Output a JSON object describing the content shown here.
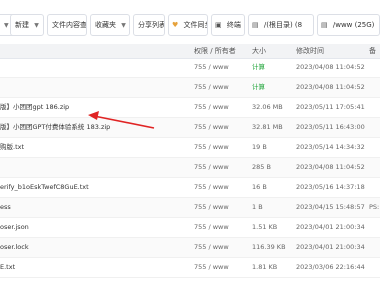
{
  "toolbar": {
    "btn_partial": "",
    "new_label": "新建",
    "search_label": "文件内容查找",
    "favorites_label": "收藏夹",
    "share_label": "分享列表",
    "sync_label": "文件同步",
    "terminal_label": "终端",
    "root_dir_label": "/(根目录) (8",
    "www_dir_label": "/www (25G)"
  },
  "table": {
    "columns": [
      "权限 / 所有者",
      "大小",
      "修改时间",
      "备"
    ],
    "rows": [
      {
        "name": "",
        "perm": "755 / www",
        "size": "计算",
        "time": "2023/04/08 11:04:52",
        "extra": "",
        "calc": true
      },
      {
        "name": "",
        "perm": "755 / www",
        "size": "计算",
        "time": "2023/04/08 11:04:52",
        "extra": "",
        "calc": true
      },
      {
        "name": "版】小团团gpt 186.zip",
        "perm": "755 / www",
        "size": "32.06 MB",
        "time": "2023/05/11 17:05:41",
        "extra": ""
      },
      {
        "name": "版】小团团GPT付费体验系统 183.zip",
        "perm": "755 / www",
        "size": "32.81 MB",
        "time": "2023/05/11 16:43:00",
        "extra": ""
      },
      {
        "name": "购版.txt",
        "perm": "755 / www",
        "size": "19 B",
        "time": "2023/05/14 14:34:32",
        "extra": ""
      },
      {
        "name": "",
        "perm": "755 / www",
        "size": "285 B",
        "time": "2023/04/08 11:04:52",
        "extra": ""
      },
      {
        "name": "erify_b1oEskTwefC8GuE.txt",
        "perm": "755 / www",
        "size": "16 B",
        "time": "2023/05/16 14:37:18",
        "extra": ""
      },
      {
        "name": "ess",
        "perm": "755 / www",
        "size": "1 B",
        "time": "2023/04/15 15:48:57",
        "extra": "PS:"
      },
      {
        "name": "oser.json",
        "perm": "755 / www",
        "size": "1.51 KB",
        "time": "2023/04/01 21:00:34",
        "extra": ""
      },
      {
        "name": "oser.lock",
        "perm": "755 / www",
        "size": "116.39 KB",
        "time": "2023/04/01 21:00:34",
        "extra": ""
      },
      {
        "name": "E.txt",
        "perm": "755 / www",
        "size": "1.81 KB",
        "time": "2023/03/06 22:16:44",
        "extra": ""
      }
    ]
  }
}
